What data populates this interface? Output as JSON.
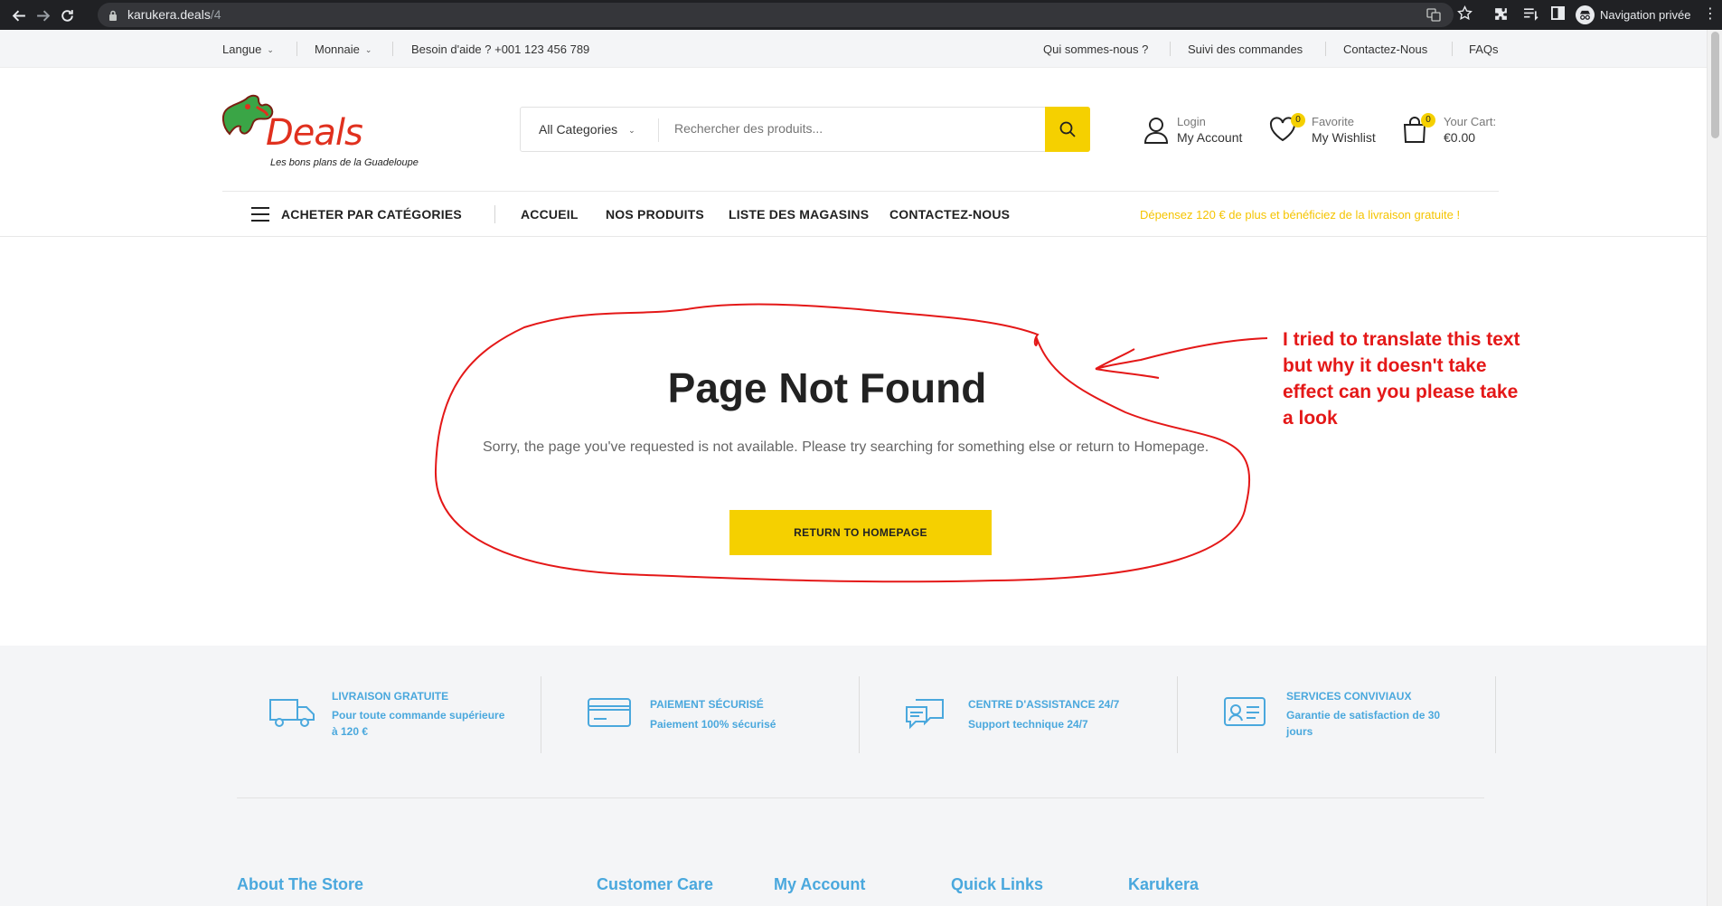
{
  "browser": {
    "url_host": "karukera.deals",
    "url_path": "/4",
    "profile_label": "Navigation privée"
  },
  "topbar": {
    "language": "Langue",
    "currency": "Monnaie",
    "help": "Besoin d'aide ? +001 123 456 789",
    "links": [
      "Qui sommes-nous ?",
      "Suivi des commandes",
      "Contactez-Nous",
      "FAQs"
    ]
  },
  "logo": {
    "brand": "Deals",
    "tagline": "Les bons plans de la Guadeloupe"
  },
  "search": {
    "category": "All Categories",
    "placeholder": "Rechercher des produits..."
  },
  "account": {
    "small": "Login",
    "big": "My Account"
  },
  "wishlist": {
    "small": "Favorite",
    "big": "My Wishlist",
    "count": "0"
  },
  "cart": {
    "small": "Your Cart:",
    "big": "€0.00",
    "count": "0"
  },
  "nav": {
    "categories": "ACHETER PAR CATÉGORIES",
    "items": [
      "ACCUEIL",
      "NOS PRODUITS",
      "LISTE DES MAGASINS",
      "CONTACTEZ-NOUS"
    ],
    "promo": "Dépensez 120 € de plus et bénéficiez de la livraison gratuite !"
  },
  "error_page": {
    "title": "Page Not Found",
    "message": "Sorry, the page you've requested is not available. Please try searching for something else or return to Homepage.",
    "button": "RETURN TO HOMEPAGE"
  },
  "annotation": {
    "note": "I tried to translate this text but why it doesn't take effect can you please take a look",
    "color": "#e41818"
  },
  "features": [
    {
      "icon": "truck-icon",
      "title": "LIVRAISON GRATUITE",
      "subtitle": "Pour toute commande supérieure à 120 €"
    },
    {
      "icon": "credit-card-icon",
      "title": "PAIEMENT SÉCURISÉ",
      "subtitle": "Paiement 100% sécurisé"
    },
    {
      "icon": "chat-icon",
      "title": "CENTRE D'ASSISTANCE 24/7",
      "subtitle": "Support technique 24/7"
    },
    {
      "icon": "id-card-icon",
      "title": "SERVICES CONVIVIAUX",
      "subtitle": "Garantie de satisfaction de 30 jours"
    }
  ],
  "footer_columns": [
    "About The Store",
    "Customer Care",
    "My Account",
    "Quick Links",
    "Karukera"
  ],
  "colors": {
    "accent": "#f5d000",
    "footer_link": "#4aa8dd",
    "promo": "#f5c400"
  }
}
